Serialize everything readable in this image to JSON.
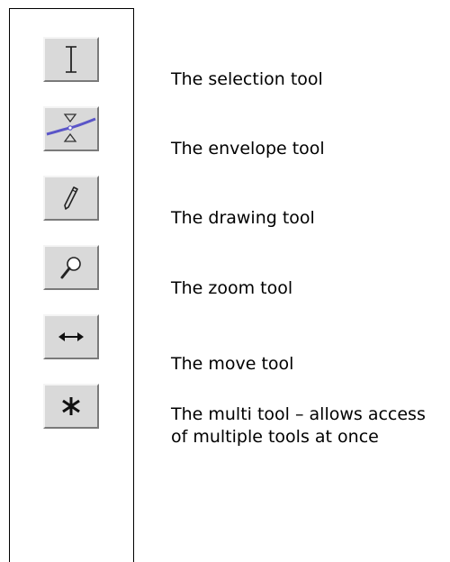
{
  "tools": [
    {
      "icon": "text-cursor-icon",
      "label": "The selection tool"
    },
    {
      "icon": "envelope-icon",
      "label": "The envelope tool"
    },
    {
      "icon": "pencil-icon",
      "label": "The drawing tool"
    },
    {
      "icon": "magnifier-icon",
      "label": "The zoom tool"
    },
    {
      "icon": "horizontal-arrows-icon",
      "label": "The move tool"
    },
    {
      "icon": "asterisk-icon",
      "label": "The multi tool – allows access of multiple tools at once"
    }
  ],
  "colors": {
    "button_face": "#d9d9d9",
    "envelope_accent": "#5a55c8"
  }
}
